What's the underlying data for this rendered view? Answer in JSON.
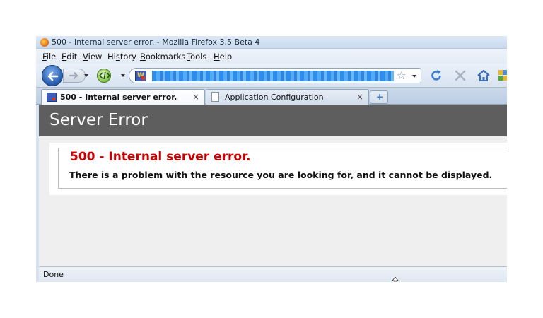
{
  "window": {
    "title": "500 - Internal server error. - Mozilla Firefox 3.5 Beta 4"
  },
  "menu": [
    {
      "accel": "F",
      "rest": "ile"
    },
    {
      "accel": "E",
      "rest": "dit"
    },
    {
      "accel": "V",
      "rest": "iew"
    },
    {
      "pre": "Hi",
      "accel": "s",
      "rest": "tory"
    },
    {
      "accel": "B",
      "rest": "ookmarks"
    },
    {
      "accel": "T",
      "rest": "ools"
    },
    {
      "accel": "H",
      "rest": "elp"
    }
  ],
  "navbar": {
    "url": "",
    "icons": {
      "back": "back-arrow-icon",
      "forward": "forward-arrow-icon",
      "reload": "reload-icon",
      "stop": "stop-icon",
      "home": "home-icon",
      "bookmark": "star-icon"
    }
  },
  "tabs": [
    {
      "label": "500 - Internal server error.",
      "active": true
    },
    {
      "label": "Application Configuration",
      "active": false
    }
  ],
  "tab_close_glyph": "×",
  "newtab_glyph": "+",
  "page": {
    "header": "Server Error",
    "error_title": "500 - Internal server error.",
    "error_message": "There is a problem with the resource you are looking for, and it cannot be displayed."
  },
  "status": "Done",
  "colors": {
    "header_bg": "#5e5e5e",
    "error_red": "#cc0000"
  }
}
